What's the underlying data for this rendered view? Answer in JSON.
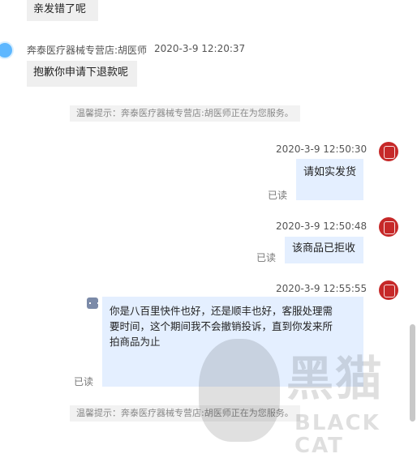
{
  "messages": {
    "m0": {
      "text": "亲发错了呢"
    },
    "m1": {
      "sender": "奔泰医疗器械专营店:胡医师",
      "time": "2020-3-9 12:20:37",
      "text": "抱歉你申请下退款呢"
    },
    "sys1": {
      "text": "温馨提示：奔泰医疗器械专营店:胡医师正在为您服务。"
    },
    "m2": {
      "time": "2020-3-9 12:50:30",
      "text": "请如实发货",
      "status": "已读"
    },
    "m3": {
      "time": "2020-3-9 12:50:48",
      "text": "该商品已拒收",
      "status": "已读"
    },
    "m4": {
      "time": "2020-3-9 12:55:55",
      "lines": [
        "你是八百里快件也好，还是顺丰也好，客服处理需",
        "要时间，这个期间我不会撤销投诉，直到你发来所",
        "拍商品为止"
      ],
      "status": "已读"
    },
    "sys2": {
      "text": "温馨提示：奔泰医疗器械专营店:胡医师正在为您服务。"
    }
  },
  "watermark": {
    "main": "黑猫",
    "sub": "BLACK CAT"
  },
  "colors": {
    "bubble_left": "#efefef",
    "bubble_right": "#e4efff",
    "avatar_user": "#c62828",
    "avatar_shop": "#5db7ff"
  }
}
